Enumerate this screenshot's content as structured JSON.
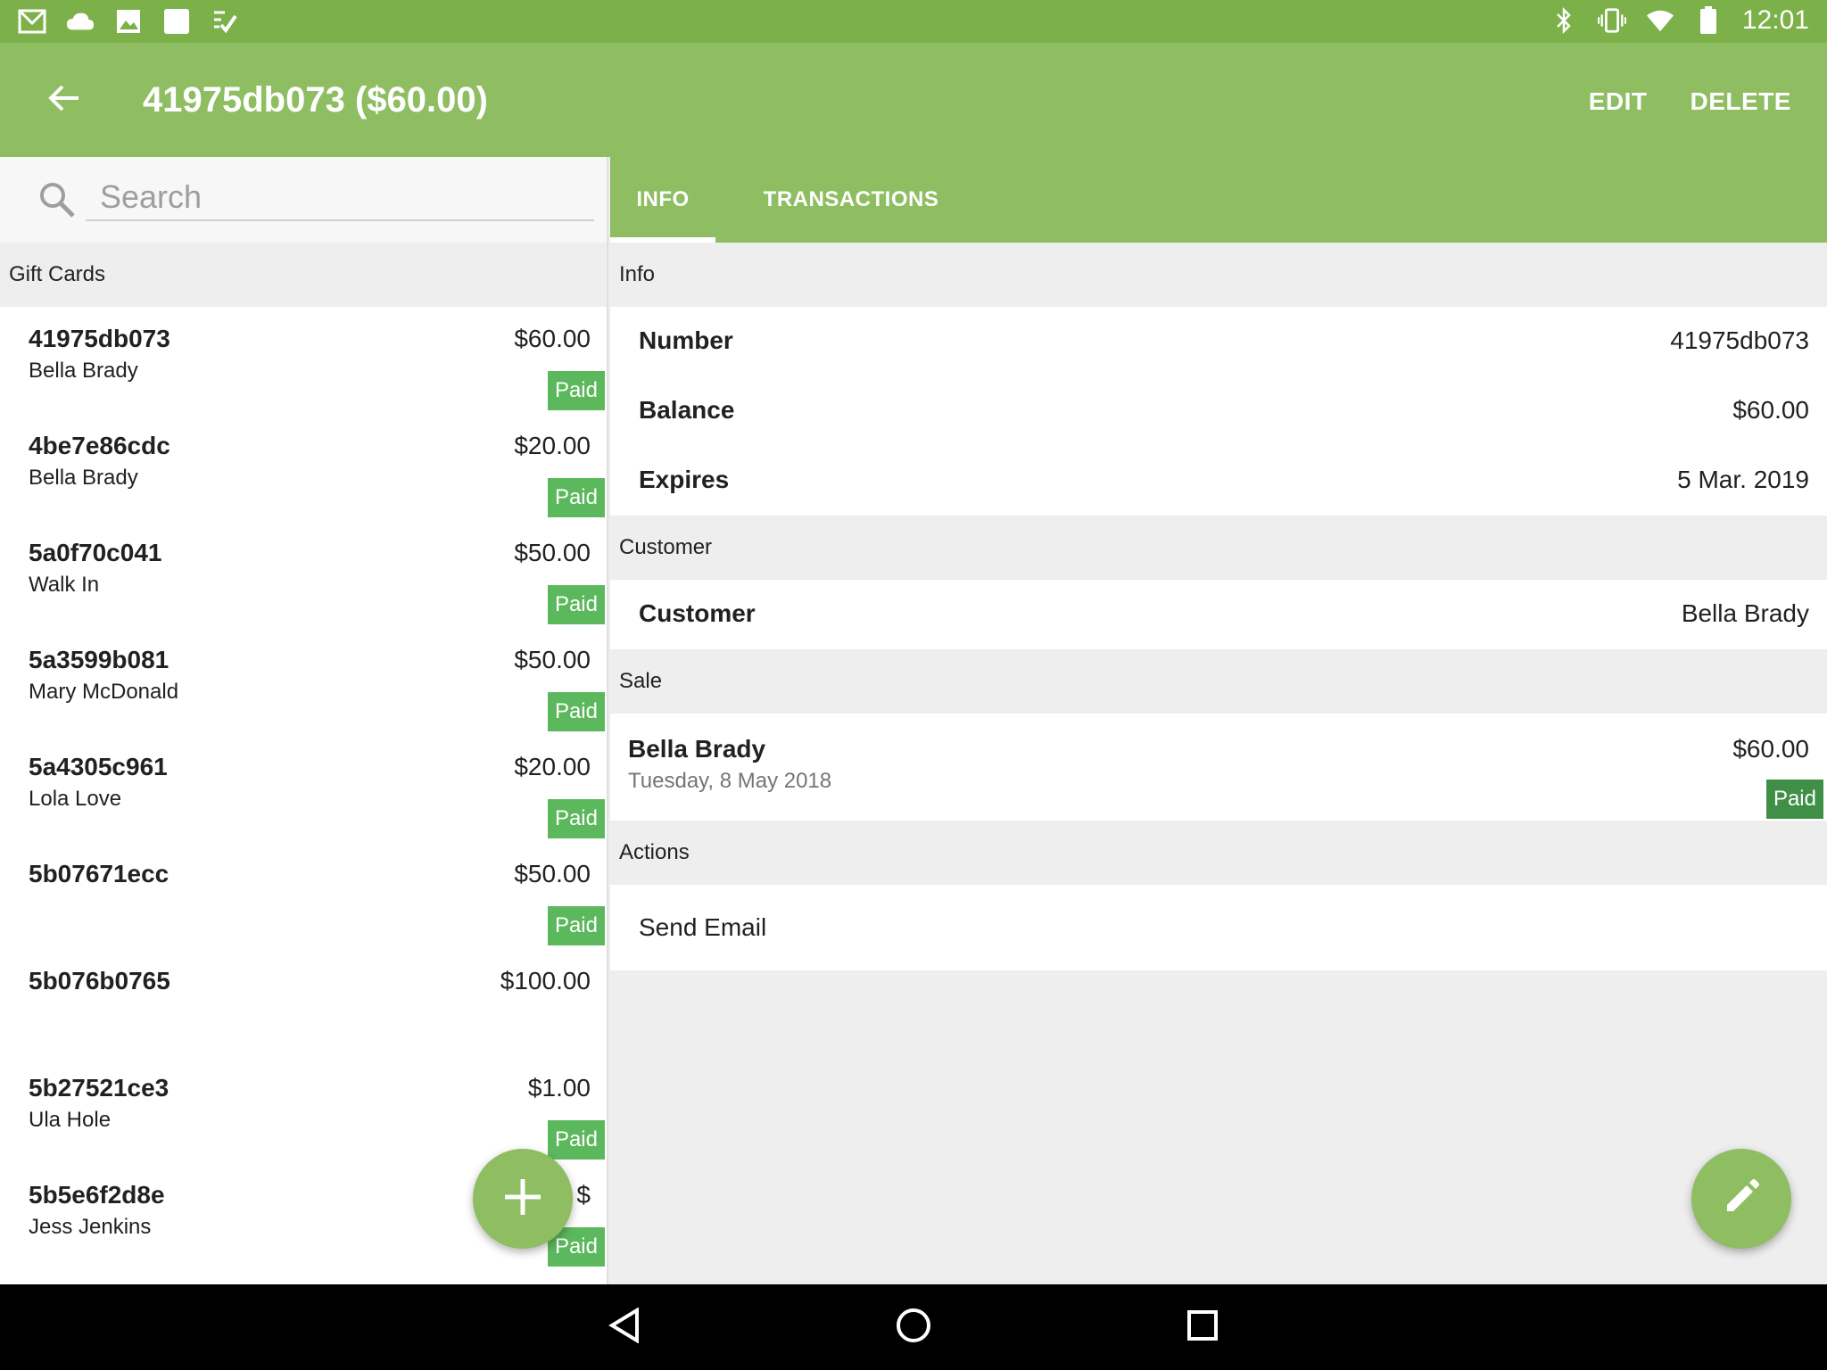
{
  "status_bar": {
    "time": "12:01",
    "left_icons": [
      "gmail-icon",
      "cloud-icon",
      "image-icon",
      "square-app-icon",
      "checklist-icon"
    ],
    "right_icons": [
      "bluetooth-icon",
      "vibrate-icon",
      "wifi-icon",
      "battery-icon"
    ]
  },
  "app_bar": {
    "title": "41975db073 ($60.00)",
    "edit_label": "EDIT",
    "delete_label": "DELETE"
  },
  "search": {
    "placeholder": "Search"
  },
  "gift_cards": {
    "header": "Gift Cards",
    "items": [
      {
        "number": "41975db073",
        "customer": "Bella Brady",
        "amount": "$60.00",
        "status": "Paid"
      },
      {
        "number": "4be7e86cdc",
        "customer": "Bella Brady",
        "amount": "$20.00",
        "status": "Paid"
      },
      {
        "number": "5a0f70c041",
        "customer": "Walk In",
        "amount": "$50.00",
        "status": "Paid"
      },
      {
        "number": "5a3599b081",
        "customer": "Mary McDonald",
        "amount": "$50.00",
        "status": "Paid"
      },
      {
        "number": "5a4305c961",
        "customer": "Lola Love",
        "amount": "$20.00",
        "status": "Paid"
      },
      {
        "number": "5b07671ecc",
        "customer": "",
        "amount": "$50.00",
        "status": "Paid"
      },
      {
        "number": "5b076b0765",
        "customer": "",
        "amount": "$100.00",
        "status": ""
      },
      {
        "number": "5b27521ce3",
        "customer": "Ula Hole",
        "amount": "$1.00",
        "status": "Paid"
      },
      {
        "number": "5b5e6f2d8e",
        "customer": "Jess Jenkins",
        "amount": "$",
        "status": "Paid"
      }
    ]
  },
  "tabs": {
    "info": "INFO",
    "transactions": "TRANSACTIONS"
  },
  "detail": {
    "info_header": "Info",
    "number_label": "Number",
    "number_value": "41975db073",
    "balance_label": "Balance",
    "balance_value": "$60.00",
    "expires_label": "Expires",
    "expires_value": "5 Mar. 2019",
    "customer_header": "Customer",
    "customer_label": "Customer",
    "customer_value": "Bella Brady",
    "sale_header": "Sale",
    "sale_name": "Bella Brady",
    "sale_date": "Tuesday, 8 May 2018",
    "sale_amount": "$60.00",
    "sale_status": "Paid",
    "actions_header": "Actions",
    "send_email": "Send Email"
  },
  "colors": {
    "status_bar": "#7cb048",
    "app_bar": "#8ebd62",
    "paid_badge": "#5cb85c",
    "sale_paid_badge": "#3f8f47"
  }
}
